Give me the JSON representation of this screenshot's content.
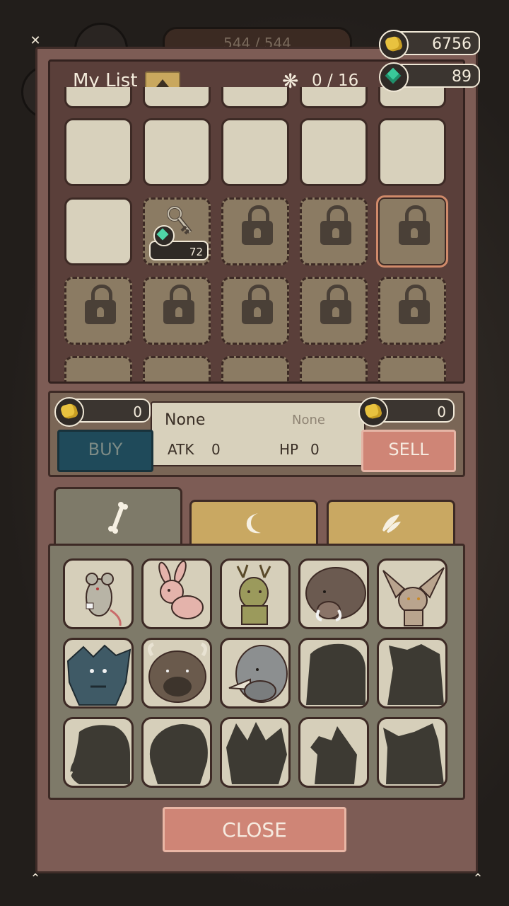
{
  "background": {
    "hp_bar_text": "544 / 544"
  },
  "currencies": {
    "gold": "6756",
    "gems": "89"
  },
  "my_list": {
    "title": "My List",
    "count": "0 / 16",
    "key_price": "72"
  },
  "trade": {
    "buy_price": "0",
    "sell_price": "0",
    "name": "None",
    "name_secondary": "None",
    "atk_label": "ATK",
    "atk_value": "0",
    "hp_label": "HP",
    "hp_value": "0",
    "buy_label": "BUY",
    "sell_label": "SELL"
  },
  "tabs": [
    {
      "icon": "bone-icon",
      "active": true
    },
    {
      "icon": "moon-claw-icon",
      "active": false
    },
    {
      "icon": "wing-icon",
      "active": false
    }
  ],
  "bestiary": [
    "rat",
    "rabbit",
    "deer",
    "boar",
    "fox",
    "wolf",
    "bison",
    "rhino",
    "locked",
    "locked",
    "locked",
    "locked",
    "locked",
    "locked",
    "locked"
  ],
  "close_label": "CLOSE",
  "colors": {
    "frame": "#7d5c55",
    "buy": "#1f4a5a",
    "sell": "#cf8576",
    "gold": "#e8c23f",
    "gem": "#39c99a"
  }
}
